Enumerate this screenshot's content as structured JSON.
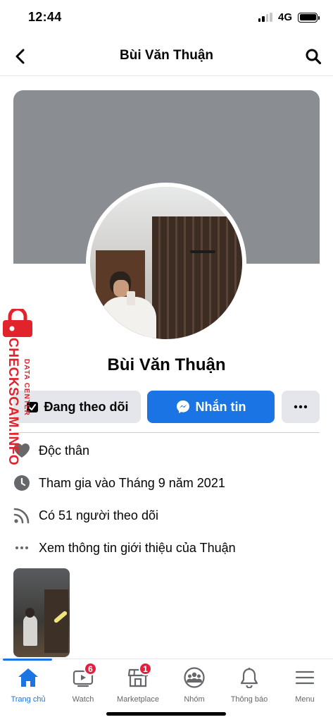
{
  "status_bar": {
    "time": "12:44",
    "network": "4G"
  },
  "header": {
    "title": "Bùi Văn Thuận"
  },
  "profile": {
    "name": "Bùi Văn Thuận",
    "following_label": "Đang theo dõi",
    "message_label": "Nhắn tin",
    "more_label": "•••"
  },
  "info": [
    {
      "icon": "heart-icon",
      "text": "Độc thân"
    },
    {
      "icon": "clock-icon",
      "text": "Tham gia vào Tháng 9 năm 2021"
    },
    {
      "icon": "rss-icon",
      "text": "Có 51 người theo dõi"
    },
    {
      "icon": "ellipsis-icon",
      "text": "Xem thông tin giới thiệu của Thuận"
    }
  ],
  "watermark": {
    "main": "CHECKSCAM.INFO",
    "sub": "DATA CENTER"
  },
  "tabs": [
    {
      "label": "Trang chủ",
      "icon": "home-icon",
      "active": true
    },
    {
      "label": "Watch",
      "icon": "watch-icon",
      "badge": "6"
    },
    {
      "label": "Marketplace",
      "icon": "marketplace-icon",
      "badge": "1"
    },
    {
      "label": "Nhóm",
      "icon": "groups-icon"
    },
    {
      "label": "Thông báo",
      "icon": "bell-icon"
    },
    {
      "label": "Menu",
      "icon": "menu-icon"
    }
  ],
  "colors": {
    "accent": "#1b74e4",
    "badge": "#e41e3f",
    "cover": "#8a8d91",
    "button_gray": "#e4e6eb",
    "watermark": "#e1232b"
  }
}
